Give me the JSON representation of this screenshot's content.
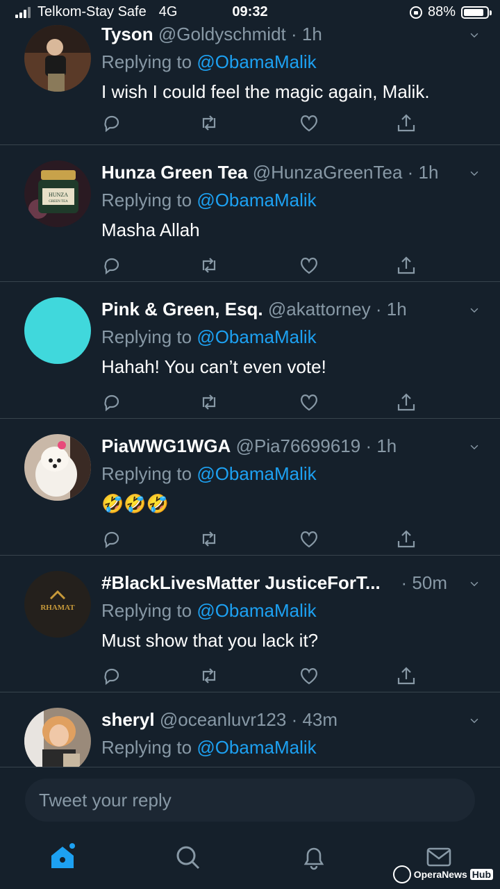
{
  "status_bar": {
    "carrier": "Telkom-Stay Safe",
    "network": "4G",
    "time": "09:32",
    "battery": "88%",
    "battery_level": 0.88,
    "icons": [
      "signal-icon",
      "orientation-lock-icon",
      "battery-icon"
    ]
  },
  "tweets": [
    {
      "name": "Tyson",
      "handle": "@Goldyschmidt",
      "time": "· 1h",
      "replying_prefix": "Replying to",
      "mention": "@ObamaMalik",
      "text": "I wish I could feel the magic again, Malik."
    },
    {
      "name": "Hunza Green Tea",
      "handle": "@HunzaGreenTea",
      "time": "· 1h",
      "replying_prefix": "Replying to",
      "mention": "@ObamaMalik",
      "text": "Masha Allah",
      "avatar_label": "HUNZA GREEN TEA"
    },
    {
      "name": "Pink & Green, Esq.",
      "handle": "@akattorney",
      "time": "· 1h",
      "replying_prefix": "Replying to",
      "mention": "@ObamaMalik",
      "text": "Hahah! You can’t even vote!",
      "avatar_color": "#40d8dc"
    },
    {
      "name": "PiaWWG1WGA",
      "handle": "@Pia76699619",
      "time": "· 1h",
      "replying_prefix": "Replying to",
      "mention": "@ObamaMalik",
      "text": "🤣🤣🤣"
    },
    {
      "name": "#BlackLivesMatter JusticeForT...",
      "handle": "",
      "time": "· 50m",
      "replying_prefix": "Replying to",
      "mention": "@ObamaMalik",
      "text": "Must show that you lack it?",
      "avatar_label": "RHAMAT"
    },
    {
      "name": "sheryl",
      "handle": "@oceanluvr123",
      "time": "· 43m",
      "replying_prefix": "Replying to",
      "mention": "@ObamaMalik",
      "text": ""
    }
  ],
  "tweet_actions": [
    "reply-icon",
    "retweet-icon",
    "like-icon",
    "share-icon"
  ],
  "reply_box": {
    "placeholder": "Tweet your reply"
  },
  "tab_bar": {
    "tabs": [
      "home-icon",
      "search-icon",
      "notifications-icon",
      "messages-icon"
    ]
  },
  "watermark": {
    "text": "OperaNews",
    "badge": "Hub"
  },
  "colors": {
    "background": "#15202b",
    "accent": "#1da1f2",
    "muted": "#8899a6",
    "divider": "#38444d"
  }
}
